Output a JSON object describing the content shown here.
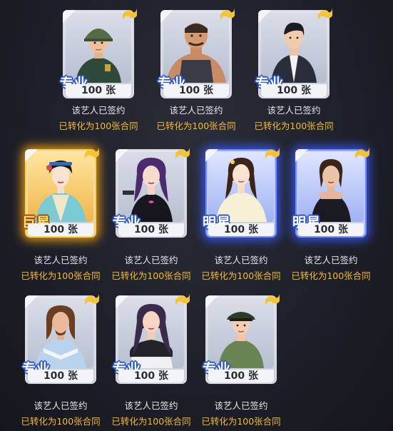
{
  "cards": [
    {
      "rank": "专业",
      "count": "100 张",
      "signed": "该艺人已签约",
      "converted": "已转化为100张合同",
      "tier": "normal",
      "avatar": "soldier-icon"
    },
    {
      "rank": "专业",
      "count": "100 张",
      "signed": "该艺人已签约",
      "converted": "已转化为100张合同",
      "tier": "normal",
      "avatar": "muscle-man-icon"
    },
    {
      "rank": "专业",
      "count": "100 张",
      "signed": "该艺人已签约",
      "converted": "已转化为100张合同",
      "tier": "normal",
      "avatar": "suit-man-icon"
    },
    {
      "rank": "巨星",
      "count": "100 张",
      "signed": "该艺人已签约",
      "converted": "已转化为100张合同",
      "tier": "gold",
      "avatar": "opera-woman-icon"
    },
    {
      "rank": "专业",
      "count": "100 张",
      "signed": "该艺人已签约",
      "converted": "已转化为100张合同",
      "tier": "normal",
      "avatar": "agent-woman-icon"
    },
    {
      "rank": "明星",
      "count": "100 张",
      "signed": "该艺人已签约",
      "converted": "已转化为100张合同",
      "tier": "blue",
      "avatar": "hanfu-woman-icon"
    },
    {
      "rank": "明星",
      "count": "100 张",
      "signed": "该艺人已签约",
      "converted": "已转化为100张合同",
      "tier": "blue",
      "avatar": "gown-woman-icon"
    },
    {
      "rank": "专业",
      "count": "100 张",
      "signed": "该艺人已签约",
      "converted": "已转化为100张合同",
      "tier": "normal",
      "avatar": "longhair-man-icon"
    },
    {
      "rank": "专业",
      "count": "100 张",
      "signed": "该艺人已签约",
      "converted": "已转化为100张合同",
      "tier": "normal",
      "avatar": "casual-woman-icon"
    },
    {
      "rank": "专业",
      "count": "100 张",
      "signed": "该艺人已签约",
      "converted": "已转化为100张合同",
      "tier": "normal",
      "avatar": "officer-icon"
    }
  ],
  "colors": {
    "gold_glow": "#ffaa14",
    "blue_glow": "#3c5aff",
    "converted_text": "#f5b93a",
    "rank_outline": "#2c55c9"
  }
}
